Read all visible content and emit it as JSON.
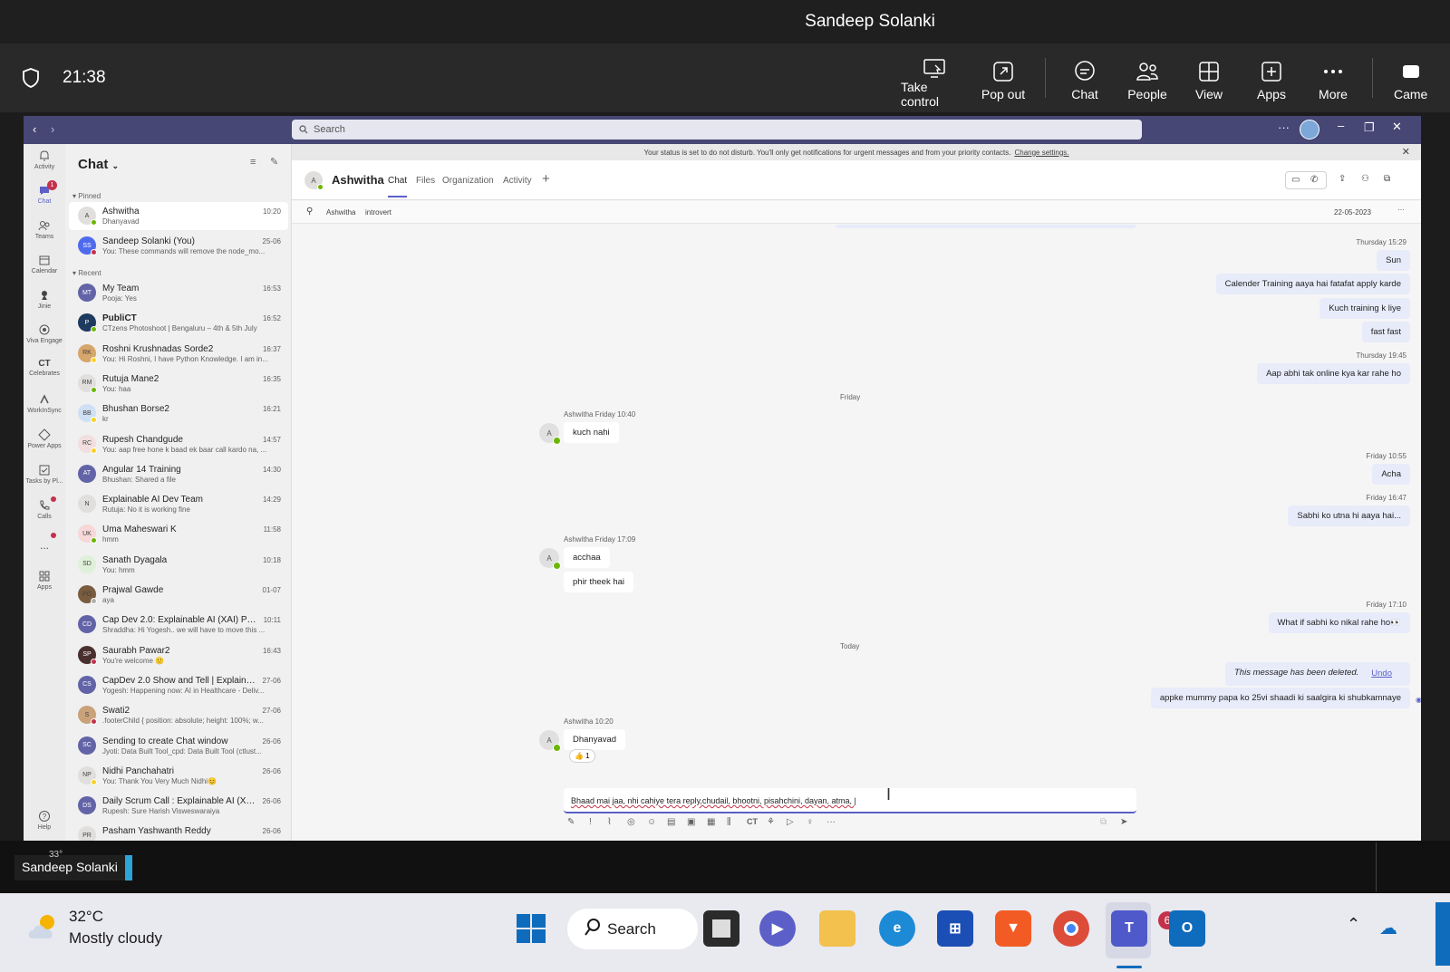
{
  "session": {
    "title": "Sandeep Solanki",
    "clock": "21:38",
    "toolbar": [
      {
        "label": "Take control",
        "icon": "take-control-icon"
      },
      {
        "label": "Pop out",
        "icon": "pop-out-icon"
      },
      {
        "label": "Chat",
        "icon": "chat-bubble-icon"
      },
      {
        "label": "People",
        "icon": "people-icon"
      },
      {
        "label": "View",
        "icon": "view-grid-icon"
      },
      {
        "label": "Apps",
        "icon": "apps-plus-icon"
      },
      {
        "label": "More",
        "icon": "more-dots-icon"
      },
      {
        "label": "Came",
        "icon": "camera-icon"
      }
    ],
    "presenter_name": "Sandeep Solanki",
    "weather_small": "33°"
  },
  "teams": {
    "search_placeholder": "Search",
    "rail": [
      {
        "label": "Activity",
        "icon": "bell-icon"
      },
      {
        "label": "Chat",
        "icon": "chat-icon",
        "badge": "1"
      },
      {
        "label": "Teams",
        "icon": "teams-icon"
      },
      {
        "label": "Calendar",
        "icon": "calendar-icon"
      },
      {
        "label": "Jinie",
        "icon": "jinie-icon"
      },
      {
        "label": "Viva Engage",
        "icon": "viva-engage-icon"
      },
      {
        "label": "Celebrates",
        "icon": "celebrates-icon"
      },
      {
        "label": "WorkInSync",
        "icon": "workinsync-icon"
      },
      {
        "label": "Power Apps",
        "icon": "power-apps-icon"
      },
      {
        "label": "Tasks by Pl...",
        "icon": "tasks-icon"
      },
      {
        "label": "Calls",
        "icon": "phone-icon"
      },
      {
        "label": "...",
        "icon": "more-horizontal-icon"
      },
      {
        "label": "Apps",
        "icon": "apps-icon"
      }
    ],
    "help_label": "Help",
    "chatlist": {
      "title": "Chat",
      "pinned_label": "Pinned",
      "recent_label": "Recent",
      "pinned": [
        {
          "initials": "A",
          "name": "Ashwitha",
          "preview": "Dhanyavad",
          "time": "10:20",
          "avatar_color": "#e1dfdd",
          "status_color": "#6bb700",
          "selected": true
        },
        {
          "initials": "SS",
          "name": "Sandeep Solanki (You)",
          "preview": "You: These commands will remove the node_mo...",
          "time": "25-06",
          "avatar_color": "#4f6bed",
          "status_color": "#c4314b"
        }
      ],
      "recent": [
        {
          "initials": "MT",
          "name": "My Team",
          "preview": "Pooja: Yes",
          "time": "16:53",
          "avatar_color": "#6264a7",
          "status_color": ""
        },
        {
          "initials": "P",
          "name": "PubliCT",
          "preview": "CTzens Photoshoot | Bengaluru – 4th & 5th July",
          "time": "16:52",
          "avatar_color": "#1e3a5f",
          "status_color": "#6bb700",
          "bold": true
        },
        {
          "initials": "RK",
          "name": "Roshni Krushnadas Sorde2",
          "preview": "You: Hi Roshni, I have Python Knowledge. I am in...",
          "time": "16:37",
          "avatar_color": "#d6a66a",
          "status_color": "#f8d22a"
        },
        {
          "initials": "RM",
          "name": "Rutuja Mane2",
          "preview": "You: haa",
          "time": "16:35",
          "avatar_color": "#e1dfdd",
          "status_color": "#6bb700"
        },
        {
          "initials": "BB",
          "name": "Bhushan Borse2",
          "preview": "kr",
          "time": "16:21",
          "avatar_color": "#cfe0f5",
          "status_color": "#f8d22a"
        },
        {
          "initials": "RC",
          "name": "Rupesh Chandgude",
          "preview": "You: aap free hone k baad ek baar call kardo na, ...",
          "time": "14:57",
          "avatar_color": "#f2dede",
          "status_color": "#f8d22a"
        },
        {
          "initials": "AT",
          "name": "Angular 14 Training",
          "preview": "Bhushan: Shared a file",
          "time": "14:30",
          "avatar_color": "#6264a7",
          "status_color": ""
        },
        {
          "initials": "N",
          "name": "Explainable AI Dev Team",
          "preview": "Rutuja: No it is working fine",
          "time": "14:29",
          "avatar_color": "#e1dfdd",
          "status_color": ""
        },
        {
          "initials": "UK",
          "name": "Uma Maheswari K",
          "preview": "hmm",
          "time": "11:58",
          "avatar_color": "#f7d7d7",
          "status_color": "#6bb700"
        },
        {
          "initials": "SD",
          "name": "Sanath Dyagala",
          "preview": "You: hmm",
          "time": "10:18",
          "avatar_color": "#dff0d8",
          "status_color": ""
        },
        {
          "initials": "PG",
          "name": "Prajwal Gawde",
          "preview": "aya",
          "time": "01-07",
          "avatar_color": "#7a5c3e",
          "status_color": "#b0b0b0"
        },
        {
          "initials": "CD",
          "name": "Cap Dev 2.0: Explainable AI (XAI) Project",
          "preview": "Shraddha: Hi Yogesh.. we will have to move this ...",
          "time": "10:11",
          "avatar_color": "#6264a7",
          "status_color": ""
        },
        {
          "initials": "SP",
          "name": "Saurabh Pawar2",
          "preview": "You're welcome 🙂",
          "time": "16:43",
          "avatar_color": "#4a2f2f",
          "status_color": "#c4314b"
        },
        {
          "initials": "CS",
          "name": "CapDev 2.0 Show and Tell | Explainabl...",
          "preview": "Yogesh: Happening now: AI in Healthcare - Deliv...",
          "time": "27-06",
          "avatar_color": "#6264a7",
          "status_color": ""
        },
        {
          "initials": "S",
          "name": "Swati2",
          "preview": ".footerChild { position: absolute; height: 100%; w...",
          "time": "27-06",
          "avatar_color": "#c9a27a",
          "status_color": "#c4314b"
        },
        {
          "initials": "SC",
          "name": "Sending to create Chat window",
          "preview": "Jyoti: Data Built Tool_cpd: Data Built Tool (ctlust...",
          "time": "26-06",
          "avatar_color": "#6264a7",
          "status_color": ""
        },
        {
          "initials": "NP",
          "name": "Nidhi Panchahatri",
          "preview": "You: Thank You Very Much Nidhi😊",
          "time": "26-06",
          "avatar_color": "#e1dfdd",
          "status_color": "#f8d22a"
        },
        {
          "initials": "DS",
          "name": "Daily Scrum Call : Explainable AI (XAI) ...",
          "preview": "Rupesh: Sure Harish Visweswaraiya",
          "time": "26-06",
          "avatar_color": "#6264a7",
          "status_color": ""
        },
        {
          "initials": "PR",
          "name": "Pasham Yashwanth Reddy",
          "preview": "",
          "time": "26-06",
          "avatar_color": "#e1dfdd",
          "status_color": ""
        }
      ]
    },
    "banner": {
      "text": "Your status is set to do not disturb. You'll only get notifications for urgent messages and from your priority contacts.",
      "link": "Change settings."
    },
    "header": {
      "name": "Ashwitha",
      "initial": "A",
      "tabs": [
        "Chat",
        "Files",
        "Organization",
        "Activity"
      ],
      "add_tab": "+"
    },
    "pinned_bar": {
      "name": "Ashwitha",
      "text": "introvert",
      "date": "22-05-2023"
    },
    "conversation": {
      "meta_thu1": "Thursday 15:29",
      "me_sun": "Sun",
      "me_cal": "Calender Training aaya hai fatafat apply karde",
      "me_kuch": "Kuch training k liye",
      "me_fast": "fast fast",
      "meta_thu2": "Thursday 19:45",
      "me_aap": "Aap abhi tak online kya kar rahe ho",
      "sep_friday": "Friday",
      "meta_them1": "Ashwitha  Friday 10:40",
      "them_kuch": "kuch nahi",
      "meta_fri1": "Friday 10:55",
      "me_acha": "Acha",
      "meta_fri2": "Friday 16:47",
      "me_sabhi": "Sabhi ko utna hi aaya hai...",
      "meta_them2": "Ashwitha  Friday 17:09",
      "them_acchaa": "acchaa",
      "them_phir": "phir theek hai",
      "meta_fri3": "Friday 17:10",
      "me_what": "What if sabhi ko nikal rahe ho👀",
      "sep_today": "Today",
      "me_deleted": "This message has been deleted.",
      "me_undo": "Undo",
      "me_appke": "appke mummy papa ko 25vi shaadi ki saalgira ki shubkamnaye",
      "meta_them3": "Ashwitha  10:20",
      "them_dhanyavad": "Dhanyavad",
      "reaction": "👍 1"
    },
    "compose": {
      "value": "Bhaad mai jaa, nhi cahiye tera reply,chudail, bhootni, pisahchini, dayan, atma, |"
    }
  },
  "taskbar": {
    "temp": "32°C",
    "condition": "Mostly cloudy",
    "search_label": "Search",
    "teams_badge": "6"
  }
}
